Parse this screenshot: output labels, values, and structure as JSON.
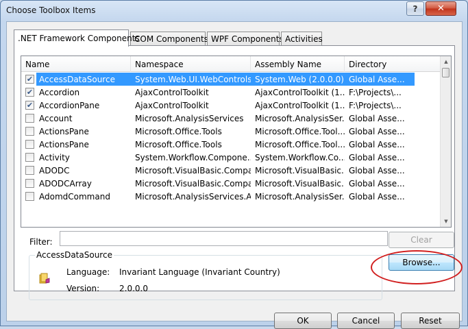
{
  "window": {
    "title": "Choose Toolbox Items",
    "help_glyph": "?",
    "close_glyph": "✕"
  },
  "tabs": [
    {
      "label": ".NET Framework Components",
      "active": true
    },
    {
      "label": "COM Components",
      "active": false
    },
    {
      "label": "WPF Components",
      "active": false
    },
    {
      "label": "Activities",
      "active": false
    }
  ],
  "grid": {
    "columns": [
      "Name",
      "Namespace",
      "Assembly Name",
      "Directory"
    ],
    "rows": [
      {
        "checked": true,
        "selected": true,
        "name": "AccessDataSource",
        "namespace": "System.Web.UI.WebControls",
        "assembly": "System.Web (2.0.0.0)",
        "directory": "Global Asse..."
      },
      {
        "checked": true,
        "selected": false,
        "name": "Accordion",
        "namespace": "AjaxControlToolkit",
        "assembly": "AjaxControlToolkit (1....",
        "directory": "F:\\Projects\\..."
      },
      {
        "checked": true,
        "selected": false,
        "name": "AccordionPane",
        "namespace": "AjaxControlToolkit",
        "assembly": "AjaxControlToolkit (1....",
        "directory": "F:\\Projects\\..."
      },
      {
        "checked": false,
        "selected": false,
        "name": "Account",
        "namespace": "Microsoft.AnalysisServices",
        "assembly": "Microsoft.AnalysisSer...",
        "directory": "Global Asse..."
      },
      {
        "checked": false,
        "selected": false,
        "name": "ActionsPane",
        "namespace": "Microsoft.Office.Tools",
        "assembly": "Microsoft.Office.Tool...",
        "directory": "Global Asse..."
      },
      {
        "checked": false,
        "selected": false,
        "name": "ActionsPane",
        "namespace": "Microsoft.Office.Tools",
        "assembly": "Microsoft.Office.Tool...",
        "directory": "Global Asse..."
      },
      {
        "checked": false,
        "selected": false,
        "name": "Activity",
        "namespace": "System.Workflow.Compone...",
        "assembly": "System.Workflow.Co...",
        "directory": "Global Asse..."
      },
      {
        "checked": false,
        "selected": false,
        "name": "ADODC",
        "namespace": "Microsoft.VisualBasic.Compa...",
        "assembly": "Microsoft.VisualBasic....",
        "directory": "Global Asse..."
      },
      {
        "checked": false,
        "selected": false,
        "name": "ADODCArray",
        "namespace": "Microsoft.VisualBasic.Compa...",
        "assembly": "Microsoft.VisualBasic....",
        "directory": "Global Asse..."
      },
      {
        "checked": false,
        "selected": false,
        "name": "AdomdCommand",
        "namespace": "Microsoft.AnalysisServices.A...",
        "assembly": "Microsoft.AnalysisSer...",
        "directory": "Global Asse..."
      }
    ],
    "check_glyph": "✔",
    "scroll_up_glyph": "▲",
    "scroll_down_glyph": "▼"
  },
  "filter": {
    "label": "Filter:",
    "value": "",
    "clear_label": "Clear"
  },
  "details": {
    "group_title": "AccessDataSource",
    "language_label": "Language:",
    "language_value": "Invariant Language (Invariant Country)",
    "version_label": "Version:",
    "version_value": "2.0.0.0"
  },
  "buttons": {
    "browse": "Browse...",
    "ok": "OK",
    "cancel": "Cancel",
    "reset": "Reset"
  },
  "colors": {
    "selection": "#3399ff",
    "annotation": "#d11f1f"
  }
}
